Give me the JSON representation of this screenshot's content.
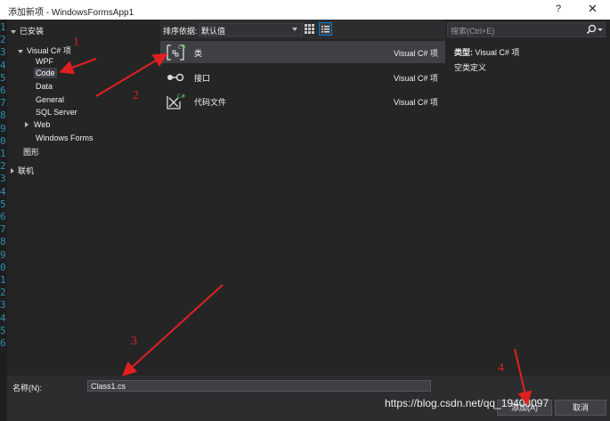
{
  "window": {
    "title": "添加新项 - WindowsFormsApp1",
    "help": "?",
    "close": "✕"
  },
  "gutter": {
    "numbers": [
      "1",
      "2",
      "3",
      "4",
      "5",
      "6",
      "7",
      "8",
      "9",
      "0",
      "1",
      "2",
      "3",
      "4",
      "5",
      "6",
      "7",
      "8",
      "9",
      "0",
      "1",
      "2",
      "3",
      "4",
      "5",
      "6"
    ]
  },
  "tree": {
    "installed_label": "已安装",
    "root_label": "Visual C# 项",
    "items": [
      "WPF",
      "Code",
      "Data",
      "General",
      "SQL Server",
      "Web",
      "Windows Forms"
    ],
    "graphics_label": "图形",
    "online_label": "联机"
  },
  "toolbar": {
    "sort_label": "排序依据:",
    "sort_value": "默认值"
  },
  "templates": [
    {
      "name": "类",
      "type": "Visual C# 项",
      "icon": "class-icon"
    },
    {
      "name": "接口",
      "type": "Visual C# 项",
      "icon": "interface-icon"
    },
    {
      "name": "代码文件",
      "type": "Visual C# 项",
      "icon": "code-file-icon"
    }
  ],
  "search": {
    "placeholder": "搜索(Ctrl+E)"
  },
  "details": {
    "type_label": "类型:",
    "type_value": "Visual C# 项",
    "description": "空类定义"
  },
  "bottom": {
    "name_label": "名称(N):",
    "name_value": "Class1.cs",
    "add_button": "添加(A)",
    "cancel_button": "取消"
  },
  "annotations": [
    "1",
    "2",
    "3",
    "4"
  ],
  "watermark": "https://blog.csdn.net/qq_19408097",
  "colors": {
    "accent": "#3f3f46",
    "annotation": "#e02020",
    "background": "#2d2d30"
  }
}
